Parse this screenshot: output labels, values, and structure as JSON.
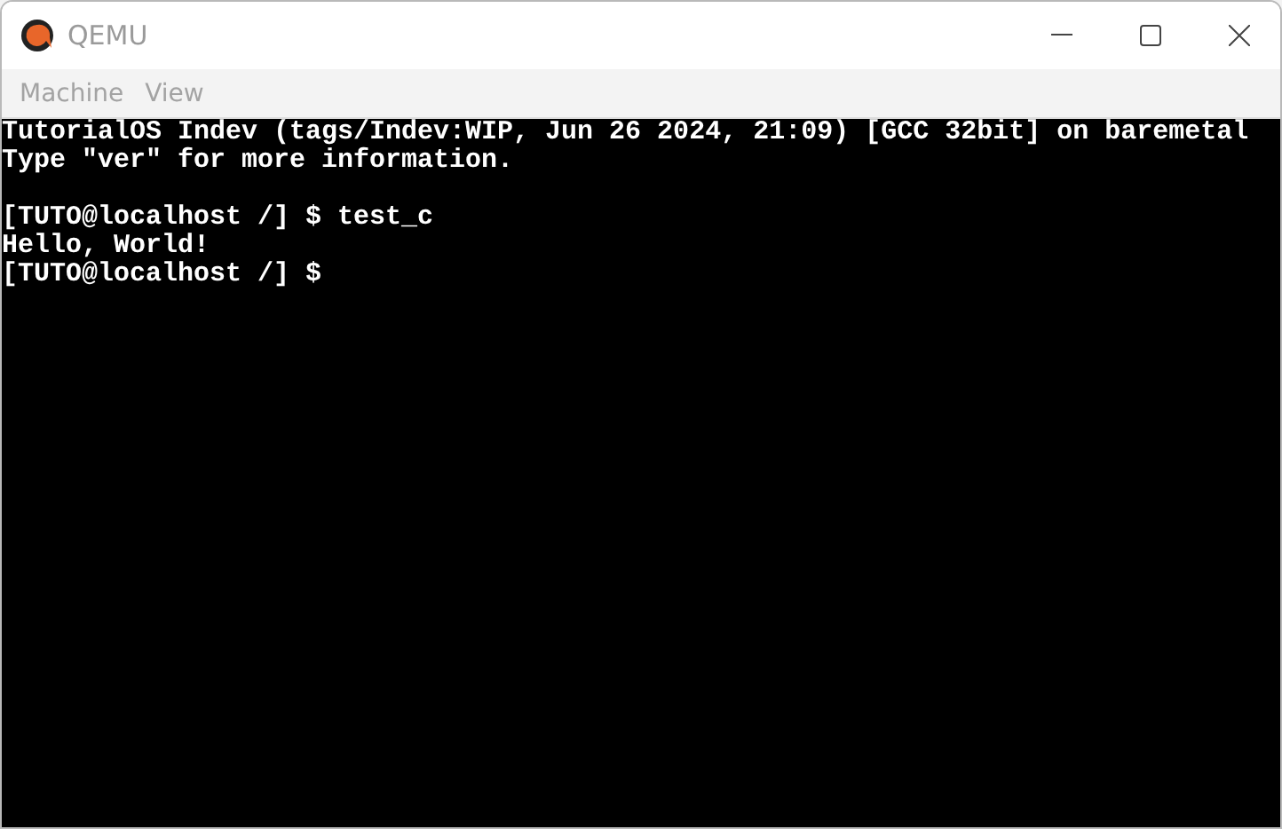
{
  "window": {
    "title": "QEMU"
  },
  "menu": [
    {
      "label": "Machine"
    },
    {
      "label": "View"
    }
  ],
  "terminal": {
    "lines": [
      {
        "kind": "text",
        "text": "TutorialOS Indev (tags/Indev:WIP, Jun 26 2024, 21:09) [GCC 32bit] on baremetal"
      },
      {
        "kind": "text",
        "text": "Type \"ver\" for more information."
      },
      {
        "kind": "gap"
      },
      {
        "kind": "text",
        "text": "[TUTO@localhost /] $ test_c"
      },
      {
        "kind": "text",
        "text": "Hello, World!"
      },
      {
        "kind": "text",
        "text": "[TUTO@localhost /] $"
      }
    ]
  }
}
